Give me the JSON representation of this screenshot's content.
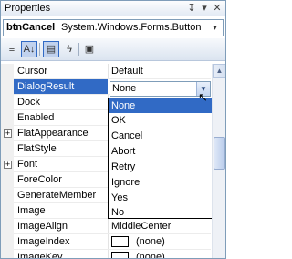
{
  "window": {
    "title": "Properties",
    "pin_glyph": "↧",
    "menu_glyph": "▾",
    "close_glyph": "✕"
  },
  "object_selector": {
    "name": "btnCancel",
    "type": "System.Windows.Forms.Button",
    "arrow": "▾"
  },
  "toolbar": {
    "categorized_glyph": "≡",
    "alphabetical_glyph": "A↓",
    "properties_glyph": "▤",
    "events_glyph": "ϟ",
    "property_pages_glyph": "▣"
  },
  "properties": [
    {
      "name": "Cursor",
      "value": "Default",
      "expandable": false
    },
    {
      "name": "DialogResult",
      "value": "None",
      "expandable": false,
      "selected": true
    },
    {
      "name": "Dock",
      "value": "",
      "expandable": false
    },
    {
      "name": "Enabled",
      "value": "",
      "expandable": false
    },
    {
      "name": "FlatAppearance",
      "value": "",
      "expandable": true
    },
    {
      "name": "FlatStyle",
      "value": "",
      "expandable": false
    },
    {
      "name": "Font",
      "value": "",
      "expandable": true
    },
    {
      "name": "ForeColor",
      "value": "",
      "expandable": false
    },
    {
      "name": "GenerateMember",
      "value": "",
      "expandable": false
    },
    {
      "name": "Image",
      "value": "",
      "expandable": false
    },
    {
      "name": "ImageAlign",
      "value": "MiddleCenter",
      "expandable": false
    },
    {
      "name": "ImageIndex",
      "value": "(none)",
      "expandable": false,
      "swatch": true
    },
    {
      "name": "ImageKey",
      "value": "(none)",
      "expandable": false,
      "swatch": true
    }
  ],
  "expand_glyph": "+",
  "dropdown": {
    "current_value": "None",
    "button_glyph": "▼",
    "options": [
      "None",
      "OK",
      "Cancel",
      "Abort",
      "Retry",
      "Ignore",
      "Yes",
      "No"
    ],
    "highlighted_index": 0
  },
  "cursor_glyph": "↖",
  "scrollbar": {
    "up_glyph": "▲"
  }
}
